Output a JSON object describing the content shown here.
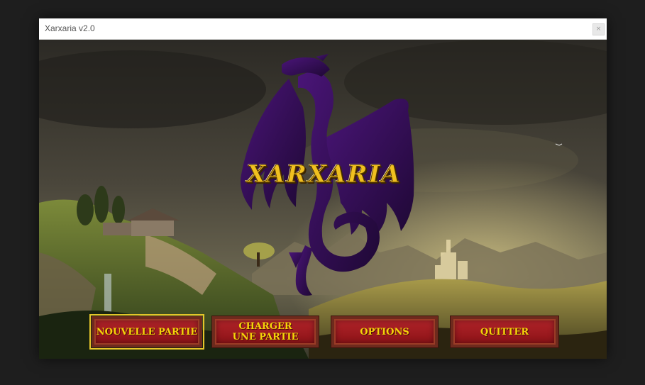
{
  "window": {
    "title": "Xarxaria v2.0",
    "close_glyph": "×"
  },
  "logo": {
    "text": "XARXARIA",
    "dragon_color": "#3b0f63",
    "text_color": "#f0c020"
  },
  "menu": {
    "buttons": [
      {
        "label": "NOUVELLE PARTIE",
        "selected": true
      },
      {
        "label": "CHARGER UNE PARTIE",
        "selected": false
      },
      {
        "label": "OPTIONS",
        "selected": false
      },
      {
        "label": "QUITTER",
        "selected": false
      }
    ],
    "button_color": "#b2242a",
    "label_color": "#f6d40a",
    "highlight_color": "#e4c52a"
  },
  "icons": {
    "close": "close-icon",
    "dragon": "dragon-icon"
  }
}
